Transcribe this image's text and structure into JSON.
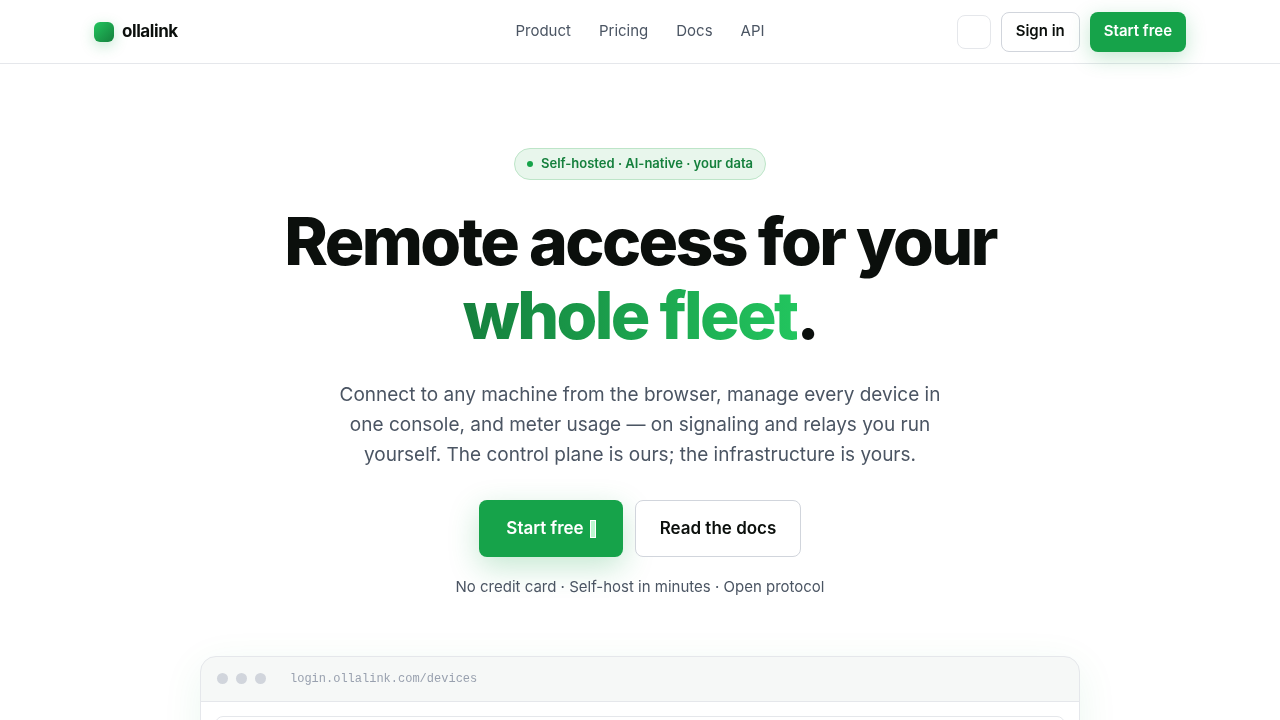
{
  "nav": {
    "brand": "ollalink",
    "links": [
      "Product",
      "Pricing",
      "Docs",
      "API"
    ],
    "sign_in": "Sign in",
    "cta": "Start free"
  },
  "hero": {
    "badge": "Self-hosted · AI-native · your data",
    "headline": "Remote access for your",
    "headline_accent": "whole fleet",
    "headline_end": ".",
    "lead": "Connect to any machine from the browser, manage every device in one console, and meter usage — on signaling and relays you run yourself. The control plane is ours; the infrastructure is yours.",
    "primary": "Start free",
    "secondary": "Read the docs",
    "note": "No credit card · Self-host in minutes · Open protocol"
  },
  "preview": {
    "url": "login.ollalink.com/devices"
  }
}
